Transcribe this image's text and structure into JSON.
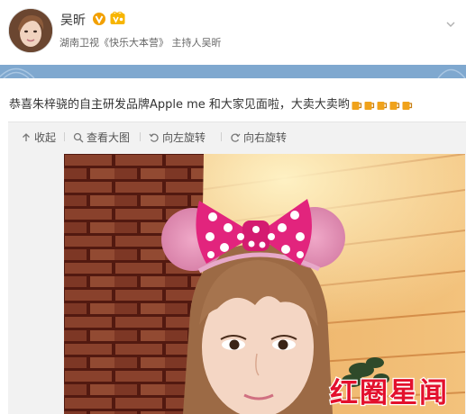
{
  "user": {
    "name": "吴昕",
    "description_prefix": "湖南卫视",
    "description_link": "《快乐大本营》",
    "description_suffix": "主持人吴昕"
  },
  "post": {
    "text": "恭喜朱梓骁的自主研发品牌Apple me 和大家见面啦，大卖大卖哟",
    "emojis": [
      "beer-emoji",
      "beer-emoji",
      "beer-emoji",
      "beer-emoji",
      "beer-emoji"
    ]
  },
  "toolbar": {
    "collapse": "收起",
    "view_large": "查看大图",
    "rotate_left": "向左旋转",
    "rotate_right": "向右旋转"
  },
  "watermark": {
    "text": "红圈星闻"
  },
  "colors": {
    "stripe": "#7fa8cf",
    "verified": "#f2a000",
    "watermark": "#e3102d"
  }
}
